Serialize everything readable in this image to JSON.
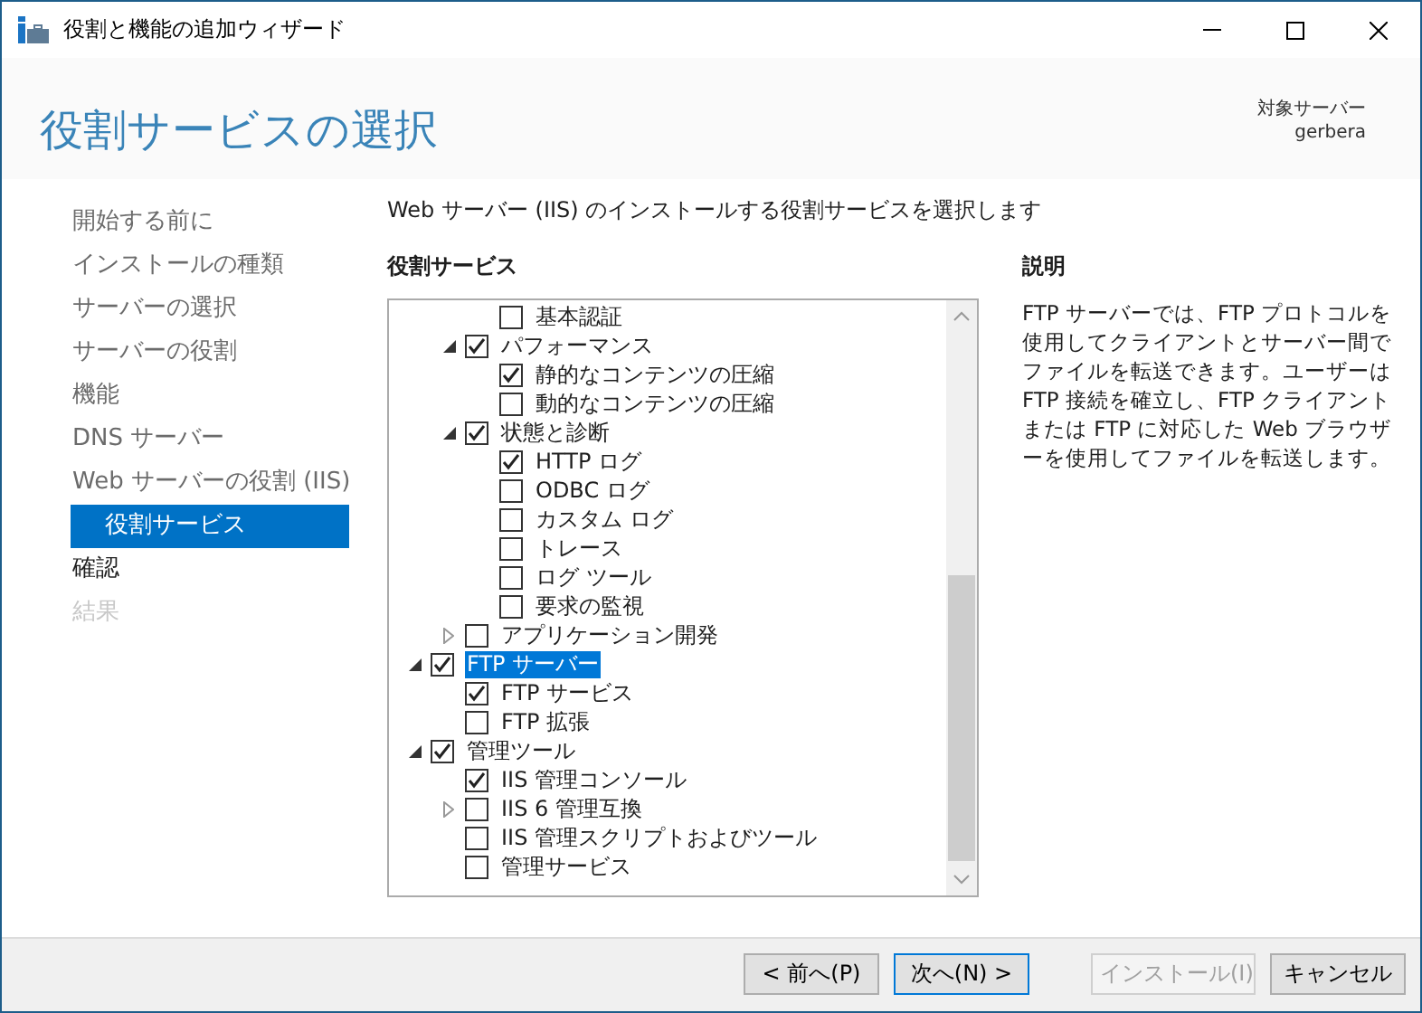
{
  "window": {
    "title": "役割と機能の追加ウィザード"
  },
  "header": {
    "title": "役割サービスの選択",
    "target_label": "対象サーバー",
    "target_server": "gerbera"
  },
  "sidebar": {
    "items": [
      {
        "label": "開始する前に",
        "selected": false,
        "kind": "done"
      },
      {
        "label": "インストールの種類",
        "selected": false,
        "kind": "done"
      },
      {
        "label": "サーバーの選択",
        "selected": false,
        "kind": "done"
      },
      {
        "label": "サーバーの役割",
        "selected": false,
        "kind": "done"
      },
      {
        "label": "機能",
        "selected": false,
        "kind": "done"
      },
      {
        "label": "DNS サーバー",
        "selected": false,
        "kind": "done"
      },
      {
        "label": "Web サーバーの役割 (IIS)",
        "selected": false,
        "kind": "done",
        "children": [
          {
            "label": "役割サービス",
            "selected": true
          }
        ]
      },
      {
        "label": "確認",
        "selected": false,
        "kind": "next"
      },
      {
        "label": "結果",
        "selected": false,
        "kind": "unavailable"
      }
    ]
  },
  "instruction": "Web サーバー (IIS) のインストールする役割サービスを選択します",
  "services": {
    "heading": "役割サービス",
    "tree": [
      {
        "children": [
          {
            "children": [
              {
                "label": "基本認証",
                "checked": false,
                "selected": false
              }
            ]
          },
          {
            "label": "パフォーマンス",
            "checked": true,
            "selected": false,
            "expanded": true,
            "children": [
              {
                "label": "静的なコンテンツの圧縮",
                "checked": true,
                "selected": false
              },
              {
                "label": "動的なコンテンツの圧縮",
                "checked": false,
                "selected": false
              }
            ]
          },
          {
            "label": "状態と診断",
            "checked": true,
            "selected": false,
            "expanded": true,
            "children": [
              {
                "label": "HTTP ログ",
                "checked": true,
                "selected": false
              },
              {
                "label": "ODBC ログ",
                "checked": false,
                "selected": false
              },
              {
                "label": "カスタム ログ",
                "checked": false,
                "selected": false
              },
              {
                "label": "トレース",
                "checked": false,
                "selected": false
              },
              {
                "label": "ログ ツール",
                "checked": false,
                "selected": false
              },
              {
                "label": "要求の監視",
                "checked": false,
                "selected": false
              }
            ]
          },
          {
            "label": "アプリケーション開発",
            "checked": false,
            "selected": false,
            "expanded": false
          }
        ]
      },
      {
        "label": "FTP サーバー",
        "checked": true,
        "selected": true,
        "expanded": true,
        "children": [
          {
            "label": "FTP サービス",
            "checked": true,
            "selected": false
          },
          {
            "label": "FTP 拡張",
            "checked": false,
            "selected": false
          }
        ]
      },
      {
        "label": "管理ツール",
        "checked": true,
        "selected": false,
        "expanded": true,
        "children": [
          {
            "label": "IIS 管理コンソール",
            "checked": true,
            "selected": false
          },
          {
            "label": "IIS 6 管理互換",
            "checked": false,
            "selected": false,
            "expanded": false
          },
          {
            "label": "IIS 管理スクリプトおよびツール",
            "checked": false,
            "selected": false
          },
          {
            "label": "管理サービス",
            "checked": false,
            "selected": false
          }
        ]
      }
    ]
  },
  "description": {
    "heading": "説明",
    "text": "FTP サーバーでは、FTP プロトコルを使用してクライアントとサーバー間でファイルを転送できます。ユーザーは FTP 接続を確立し、FTP クライアントまたは FTP に対応した Web ブラウザーを使用してファイルを転送します。"
  },
  "buttons": [
    {
      "label": "< 前へ(P)",
      "default": false,
      "disabled": false
    },
    {
      "label": "次へ(N) >",
      "default": true,
      "disabled": false
    },
    {
      "label": "インストール(I)",
      "default": false,
      "disabled": true
    },
    {
      "label": "キャンセル",
      "default": false,
      "disabled": false
    }
  ]
}
